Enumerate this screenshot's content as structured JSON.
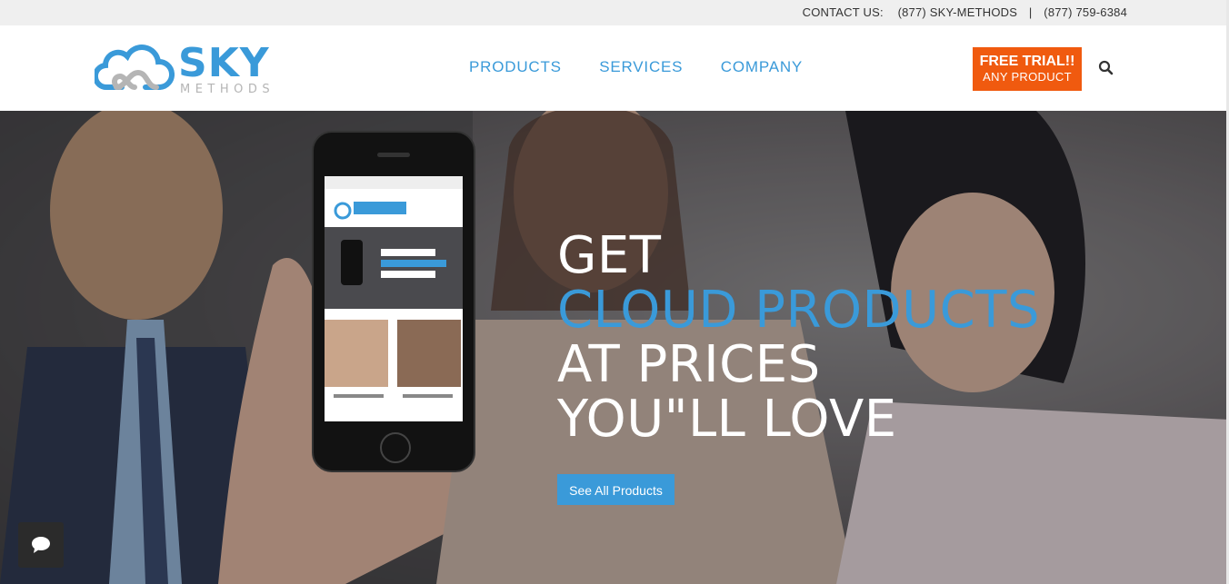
{
  "topbar": {
    "contact_label": "CONTACT US:",
    "phone_text": "(877) SKY-METHODS",
    "separator": "|",
    "phone_number": "(877) 759-6384"
  },
  "logo": {
    "name": "SKY",
    "sub": "METHODS",
    "icon": "cloud-logo-icon"
  },
  "nav": {
    "items": [
      {
        "label": "PRODUCTS"
      },
      {
        "label": "SERVICES"
      },
      {
        "label": "COMPANY"
      }
    ]
  },
  "trial_button": {
    "line1": "FREE TRIAL!!",
    "line2": "ANY PRODUCT"
  },
  "search": {
    "icon": "search-icon"
  },
  "hero": {
    "line1": "GET",
    "line2": "CLOUD PRODUCTS",
    "line3": "AT PRICES",
    "line4": "YOU\"LL LOVE",
    "cta_label": "See All Products"
  },
  "chat": {
    "icon": "chat-bubble-icon"
  },
  "colors": {
    "brand_blue": "#3a9ad9",
    "trial_orange": "#f05a0f",
    "topbar_bg": "#efefef"
  }
}
